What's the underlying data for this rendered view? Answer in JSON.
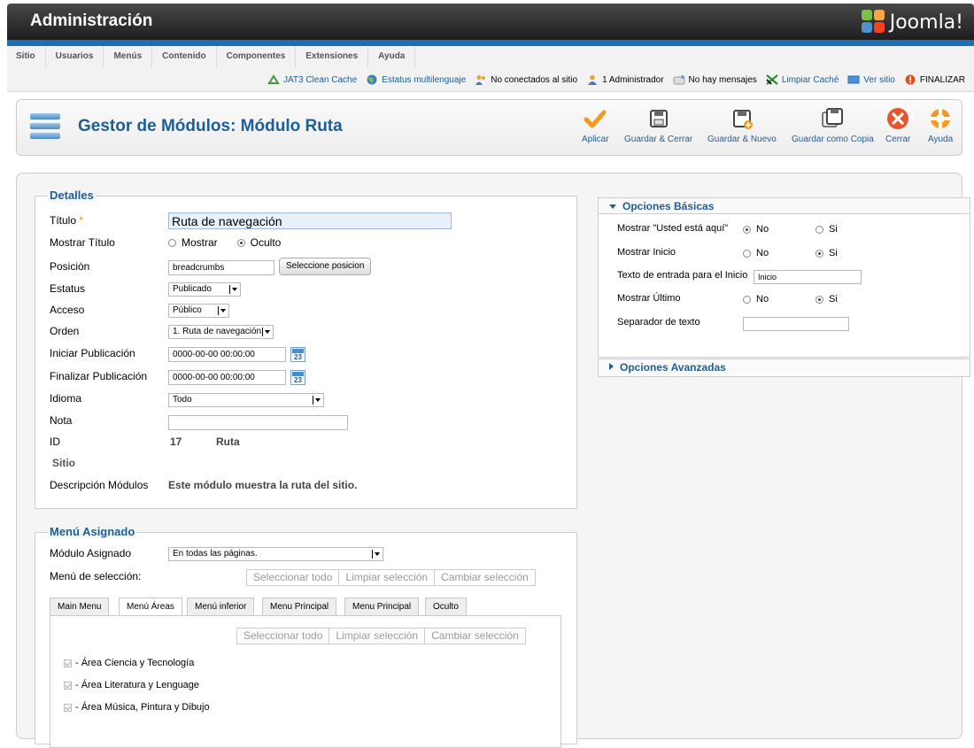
{
  "header": {
    "title": "Administración",
    "logo_text": "Joomla!"
  },
  "menu": {
    "items": [
      "Sitio",
      "Usuarios",
      "Menús",
      "Contenido",
      "Componentes",
      "Extensiones",
      "Ayuda"
    ]
  },
  "status": {
    "jat3": "JAT3 Clean Cache",
    "multilang": "Estatus multilenguaje",
    "not_connected": "No conectados al sitio",
    "admins": "1 Administrador",
    "messages": "No hay mensajes",
    "clear_cache": "Limpiar Caché",
    "view_site": "Ver sitio",
    "logout": "FINALIZAR"
  },
  "toolbar": {
    "title": "Gestor de Módulos: Módulo Ruta",
    "apply": "Aplicar",
    "save_close": "Guardar & Cerrar",
    "save_new": "Guardar & Nuevo",
    "save_copy": "Guardar como Copia",
    "close": "Cerrar",
    "help": "Ayuda"
  },
  "details": {
    "legend": "Detalles",
    "title_label": "Título",
    "required_mark": "*",
    "title_value": "Ruta de navegación",
    "show_title_label": "Mostrar Título",
    "show_title_show": "Mostrar",
    "show_title_hide": "Oculto",
    "position_label": "Posición",
    "position_value": "breadcrumbs",
    "position_button": "Seleccione posicion",
    "status_label": "Estatus",
    "status_value": "Publicado",
    "access_label": "Acceso",
    "access_value": "Público",
    "order_label": "Orden",
    "order_value": "1. Ruta de navegación",
    "start_label": "Iniciar Publicación",
    "start_value": "0000-00-00 00:00:00",
    "finish_label": "Finalizar Publicación",
    "finish_value": "0000-00-00 00:00:00",
    "calendar_day": "23",
    "language_label": "Idioma",
    "language_value": "Todo",
    "note_label": "Nota",
    "note_value": "",
    "id_label": "ID",
    "id_value": "17",
    "module_type": "Ruta",
    "site_label": "Sitio",
    "desc_label": "Descripción Módulos",
    "desc_value": "Este módulo muestra la ruta del sitio."
  },
  "assignment": {
    "legend": "Menú Asignado",
    "module_label": "Módulo Asignado",
    "module_value": "En todas las páginas.",
    "selection_label": "Menú de selección:",
    "select_all": "Seleccionar todo",
    "clear_selection": "Limpiar selección",
    "toggle_selection": "Cambiar selección",
    "tabs": [
      "Main Menu",
      "Menú Áreas",
      "Menú inferior",
      "Menu Principal",
      "Menu Principal",
      "Oculto"
    ],
    "items": [
      "- Área Ciencia y Tecnología",
      "- Área Literatura y Lenguage",
      "- Área Música, Pintura y Dibujo"
    ]
  },
  "basic": {
    "heading": "Opciones Básicas",
    "you_are_here_label": "Mostrar \"Usted está aquí\"",
    "home_label": "Mostrar Inicio",
    "home_text_label": "Texto de entrada para el Inicio",
    "home_text_value": "Inicio",
    "last_label": "Mostrar Último",
    "separator_label": "Separador de texto",
    "separator_value": "",
    "no": "No",
    "yes": "Si"
  },
  "advanced": {
    "heading": "Opciones Avanzadas"
  }
}
